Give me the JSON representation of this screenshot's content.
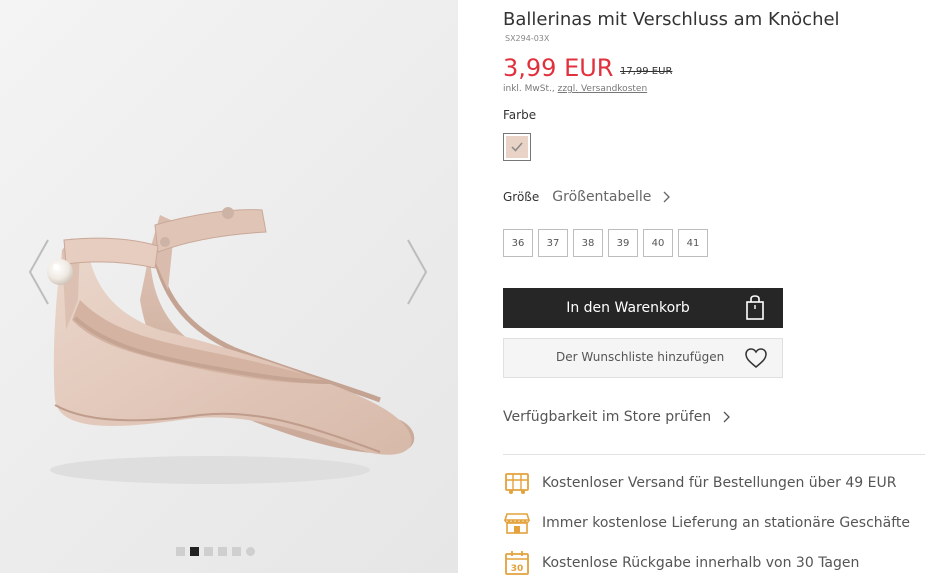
{
  "product": {
    "title": "Ballerinas mit Verschluss am Knöchel",
    "sku": "SX294-03X",
    "price": "3,99 EUR",
    "old_price": "17,99 EUR",
    "vat_text": "inkl. MwSt., ",
    "shipping_link": "zzgl. Versandkosten",
    "price_color": "#e0313d"
  },
  "color": {
    "label": "Farbe",
    "swatch_color": "#e9d3c7"
  },
  "size": {
    "label": "Größe",
    "table_link": "Größentabelle",
    "options": [
      "36",
      "37",
      "38",
      "39",
      "40",
      "41"
    ]
  },
  "actions": {
    "cart_label": "In den Warenkorb",
    "wishlist_label": "Der Wunschliste hinzufügen",
    "store_check": "Verfügbarkeit im Store prüfen"
  },
  "benefits": [
    {
      "icon": "truck-icon",
      "text": "Kostenloser Versand für Bestellungen über 49 EUR"
    },
    {
      "icon": "store-icon",
      "text": "Immer kostenlose Lieferung an stationäre Geschäfte"
    },
    {
      "icon": "calendar-30-icon",
      "text": "Kostenlose Rückgabe innerhalb von 30 Tagen",
      "badge": "30"
    }
  ],
  "gallery": {
    "slide_count": 6,
    "active_slide": 2
  },
  "colors": {
    "accent_gold": "#e3a23c",
    "button_dark": "#262626"
  }
}
